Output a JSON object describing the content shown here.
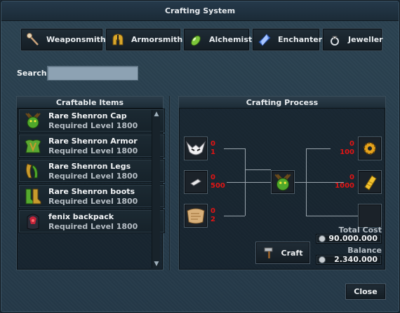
{
  "window": {
    "title": "Crafting System"
  },
  "colors": {
    "count_red": "#e21414",
    "panel_bg": "#253948"
  },
  "tabs": [
    {
      "label": "Weaponsmith",
      "icon": "staff-icon"
    },
    {
      "label": "Armorsmith",
      "icon": "golden-helmet-icon"
    },
    {
      "label": "Alchemist",
      "icon": "green-potion-icon"
    },
    {
      "label": "Enchanter",
      "icon": "blue-crystal-icon"
    },
    {
      "label": "Jeweller",
      "icon": "gem-ring-icon"
    }
  ],
  "search": {
    "label": "Search",
    "value": "",
    "placeholder": ""
  },
  "craftable": {
    "title": "Craftable Items",
    "items": [
      {
        "name": "Rare Shenron Cap",
        "req": "Required Level 1800",
        "icon": "shenron-cap-icon"
      },
      {
        "name": "Rare Shenron Armor",
        "req": "Required Level 1800",
        "icon": "shenron-armor-icon"
      },
      {
        "name": "Rare Shenron Legs",
        "req": "Required Level 1800",
        "icon": "shenron-legs-icon"
      },
      {
        "name": "Rare Shenron boots",
        "req": "Required Level 1800",
        "icon": "shenron-boots-icon"
      },
      {
        "name": "fenix backpack",
        "req": "Required Level 1800",
        "icon": "fenix-backpack-icon"
      }
    ]
  },
  "process": {
    "title": "Crafting Process",
    "inputs_left": [
      {
        "icon": "white-mask-icon",
        "have": "0",
        "need": "1"
      },
      {
        "icon": "white-shard-icon",
        "have": "0",
        "need": "500"
      },
      {
        "icon": "parchment-icon",
        "have": "0",
        "need": "2"
      }
    ],
    "inputs_right": [
      {
        "icon": "gold-gear-icon",
        "have": "0",
        "need": "100"
      },
      {
        "icon": "gold-bar-icon",
        "have": "0",
        "need": "1000"
      },
      {
        "icon": "empty-slot-icon",
        "have": "",
        "need": ""
      }
    ],
    "result_icon": "shenron-cap-icon",
    "total_cost_label": "Total Cost",
    "total_cost": "90.000.000",
    "balance_label": "Balance",
    "balance": "2.340.000",
    "craft_label": "Craft"
  },
  "close_label": "Close"
}
